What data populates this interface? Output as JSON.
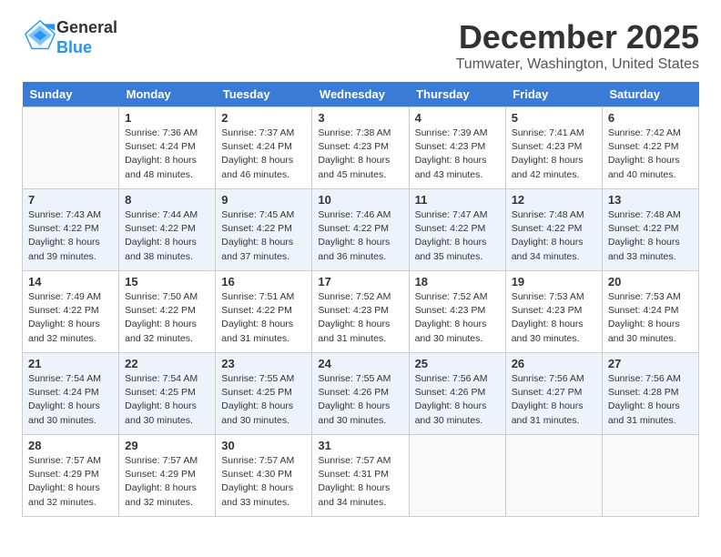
{
  "header": {
    "logo_general": "General",
    "logo_blue": "Blue",
    "month_title": "December 2025",
    "location": "Tumwater, Washington, United States"
  },
  "weekdays": [
    "Sunday",
    "Monday",
    "Tuesday",
    "Wednesday",
    "Thursday",
    "Friday",
    "Saturday"
  ],
  "weeks": [
    [
      {
        "day": "",
        "detail": ""
      },
      {
        "day": "1",
        "detail": "Sunrise: 7:36 AM\nSunset: 4:24 PM\nDaylight: 8 hours\nand 48 minutes."
      },
      {
        "day": "2",
        "detail": "Sunrise: 7:37 AM\nSunset: 4:24 PM\nDaylight: 8 hours\nand 46 minutes."
      },
      {
        "day": "3",
        "detail": "Sunrise: 7:38 AM\nSunset: 4:23 PM\nDaylight: 8 hours\nand 45 minutes."
      },
      {
        "day": "4",
        "detail": "Sunrise: 7:39 AM\nSunset: 4:23 PM\nDaylight: 8 hours\nand 43 minutes."
      },
      {
        "day": "5",
        "detail": "Sunrise: 7:41 AM\nSunset: 4:23 PM\nDaylight: 8 hours\nand 42 minutes."
      },
      {
        "day": "6",
        "detail": "Sunrise: 7:42 AM\nSunset: 4:22 PM\nDaylight: 8 hours\nand 40 minutes."
      }
    ],
    [
      {
        "day": "7",
        "detail": "Sunrise: 7:43 AM\nSunset: 4:22 PM\nDaylight: 8 hours\nand 39 minutes."
      },
      {
        "day": "8",
        "detail": "Sunrise: 7:44 AM\nSunset: 4:22 PM\nDaylight: 8 hours\nand 38 minutes."
      },
      {
        "day": "9",
        "detail": "Sunrise: 7:45 AM\nSunset: 4:22 PM\nDaylight: 8 hours\nand 37 minutes."
      },
      {
        "day": "10",
        "detail": "Sunrise: 7:46 AM\nSunset: 4:22 PM\nDaylight: 8 hours\nand 36 minutes."
      },
      {
        "day": "11",
        "detail": "Sunrise: 7:47 AM\nSunset: 4:22 PM\nDaylight: 8 hours\nand 35 minutes."
      },
      {
        "day": "12",
        "detail": "Sunrise: 7:48 AM\nSunset: 4:22 PM\nDaylight: 8 hours\nand 34 minutes."
      },
      {
        "day": "13",
        "detail": "Sunrise: 7:48 AM\nSunset: 4:22 PM\nDaylight: 8 hours\nand 33 minutes."
      }
    ],
    [
      {
        "day": "14",
        "detail": "Sunrise: 7:49 AM\nSunset: 4:22 PM\nDaylight: 8 hours\nand 32 minutes."
      },
      {
        "day": "15",
        "detail": "Sunrise: 7:50 AM\nSunset: 4:22 PM\nDaylight: 8 hours\nand 32 minutes."
      },
      {
        "day": "16",
        "detail": "Sunrise: 7:51 AM\nSunset: 4:22 PM\nDaylight: 8 hours\nand 31 minutes."
      },
      {
        "day": "17",
        "detail": "Sunrise: 7:52 AM\nSunset: 4:23 PM\nDaylight: 8 hours\nand 31 minutes."
      },
      {
        "day": "18",
        "detail": "Sunrise: 7:52 AM\nSunset: 4:23 PM\nDaylight: 8 hours\nand 30 minutes."
      },
      {
        "day": "19",
        "detail": "Sunrise: 7:53 AM\nSunset: 4:23 PM\nDaylight: 8 hours\nand 30 minutes."
      },
      {
        "day": "20",
        "detail": "Sunrise: 7:53 AM\nSunset: 4:24 PM\nDaylight: 8 hours\nand 30 minutes."
      }
    ],
    [
      {
        "day": "21",
        "detail": "Sunrise: 7:54 AM\nSunset: 4:24 PM\nDaylight: 8 hours\nand 30 minutes."
      },
      {
        "day": "22",
        "detail": "Sunrise: 7:54 AM\nSunset: 4:25 PM\nDaylight: 8 hours\nand 30 minutes."
      },
      {
        "day": "23",
        "detail": "Sunrise: 7:55 AM\nSunset: 4:25 PM\nDaylight: 8 hours\nand 30 minutes."
      },
      {
        "day": "24",
        "detail": "Sunrise: 7:55 AM\nSunset: 4:26 PM\nDaylight: 8 hours\nand 30 minutes."
      },
      {
        "day": "25",
        "detail": "Sunrise: 7:56 AM\nSunset: 4:26 PM\nDaylight: 8 hours\nand 30 minutes."
      },
      {
        "day": "26",
        "detail": "Sunrise: 7:56 AM\nSunset: 4:27 PM\nDaylight: 8 hours\nand 31 minutes."
      },
      {
        "day": "27",
        "detail": "Sunrise: 7:56 AM\nSunset: 4:28 PM\nDaylight: 8 hours\nand 31 minutes."
      }
    ],
    [
      {
        "day": "28",
        "detail": "Sunrise: 7:57 AM\nSunset: 4:29 PM\nDaylight: 8 hours\nand 32 minutes."
      },
      {
        "day": "29",
        "detail": "Sunrise: 7:57 AM\nSunset: 4:29 PM\nDaylight: 8 hours\nand 32 minutes."
      },
      {
        "day": "30",
        "detail": "Sunrise: 7:57 AM\nSunset: 4:30 PM\nDaylight: 8 hours\nand 33 minutes."
      },
      {
        "day": "31",
        "detail": "Sunrise: 7:57 AM\nSunset: 4:31 PM\nDaylight: 8 hours\nand 34 minutes."
      },
      {
        "day": "",
        "detail": ""
      },
      {
        "day": "",
        "detail": ""
      },
      {
        "day": "",
        "detail": ""
      }
    ]
  ]
}
